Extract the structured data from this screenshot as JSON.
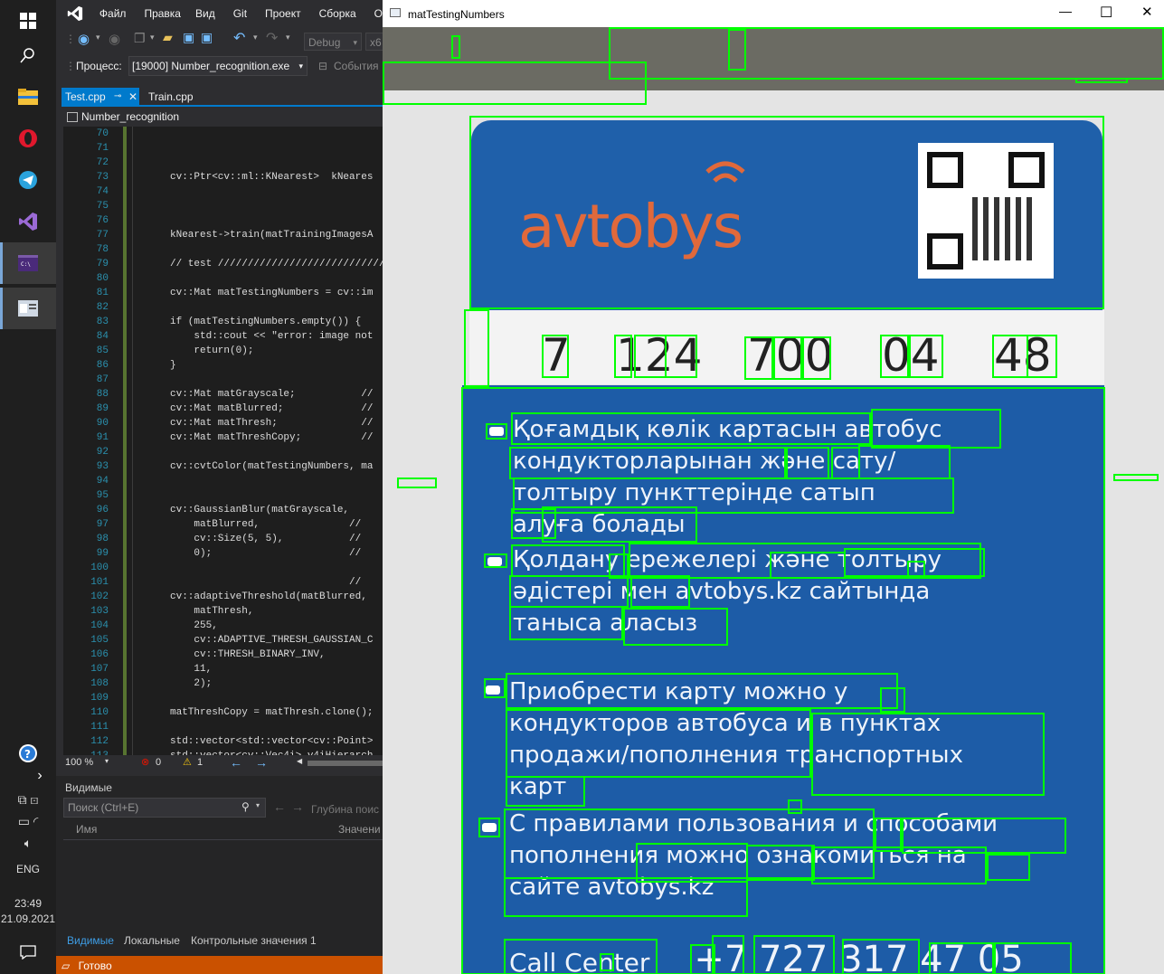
{
  "taskbar": {
    "time": "23:49",
    "date": "21.09.2021",
    "lang": "ENG"
  },
  "vs": {
    "menu": [
      "Файл",
      "Правка",
      "Вид",
      "Git",
      "Проект",
      "Сборка",
      "О"
    ],
    "config": "Debug",
    "platform": "x6",
    "process_label": "Процесс:",
    "process_value": "[19000] Number_recognition.exe",
    "events_label": "События",
    "tabs": [
      "Test.cpp",
      "Train.cpp"
    ],
    "breadcrumb": "Number_recognition",
    "code_lines": [
      {
        "n": "70",
        "t": ""
      },
      {
        "n": "71",
        "t": ""
      },
      {
        "n": "72",
        "t": ""
      },
      {
        "n": "73",
        "t": "cv::Ptr<cv::ml::KNearest>  kNeares"
      },
      {
        "n": "74",
        "t": ""
      },
      {
        "n": "75",
        "t": ""
      },
      {
        "n": "76",
        "t": ""
      },
      {
        "n": "77",
        "t": "kNearest->train(matTrainingImagesA"
      },
      {
        "n": "78",
        "t": ""
      },
      {
        "n": "79",
        "t": "// test ////////////////////////////"
      },
      {
        "n": "80",
        "t": ""
      },
      {
        "n": "81",
        "t": "cv::Mat matTestingNumbers = cv::im"
      },
      {
        "n": "82",
        "t": ""
      },
      {
        "n": "83",
        "t": "if (matTestingNumbers.empty()) {"
      },
      {
        "n": "84",
        "t": "    std::cout << \"error: image not"
      },
      {
        "n": "85",
        "t": "    return(0);"
      },
      {
        "n": "86",
        "t": "}"
      },
      {
        "n": "87",
        "t": ""
      },
      {
        "n": "88",
        "t": "cv::Mat matGrayscale;           //"
      },
      {
        "n": "89",
        "t": "cv::Mat matBlurred;             //"
      },
      {
        "n": "90",
        "t": "cv::Mat matThresh;              //"
      },
      {
        "n": "91",
        "t": "cv::Mat matThreshCopy;          //"
      },
      {
        "n": "92",
        "t": ""
      },
      {
        "n": "93",
        "t": "cv::cvtColor(matTestingNumbers, ma"
      },
      {
        "n": "94",
        "t": ""
      },
      {
        "n": "95",
        "t": ""
      },
      {
        "n": "96",
        "t": "cv::GaussianBlur(matGrayscale,"
      },
      {
        "n": "97",
        "t": "    matBlurred,               //"
      },
      {
        "n": "98",
        "t": "    cv::Size(5, 5),           //"
      },
      {
        "n": "99",
        "t": "    0);                       //"
      },
      {
        "n": "100",
        "t": ""
      },
      {
        "n": "101",
        "t": "                              //"
      },
      {
        "n": "102",
        "t": "cv::adaptiveThreshold(matBlurred,"
      },
      {
        "n": "103",
        "t": "    matThresh,"
      },
      {
        "n": "104",
        "t": "    255,"
      },
      {
        "n": "105",
        "t": "    cv::ADAPTIVE_THRESH_GAUSSIAN_C"
      },
      {
        "n": "106",
        "t": "    cv::THRESH_BINARY_INV,"
      },
      {
        "n": "107",
        "t": "    11,"
      },
      {
        "n": "108",
        "t": "    2);"
      },
      {
        "n": "109",
        "t": ""
      },
      {
        "n": "110",
        "t": "matThreshCopy = matThresh.clone();"
      },
      {
        "n": "111",
        "t": ""
      },
      {
        "n": "112",
        "t": "std::vector<std::vector<cv::Point>"
      },
      {
        "n": "113",
        "t": "std::vector<cv::Vec4i> v4iHierarch"
      }
    ],
    "zoom": "100 %",
    "errors": "0",
    "warnings": "1",
    "panel_title": "Видимые",
    "search_placeholder": "Поиск (Ctrl+E)",
    "depth_label": "Глубина поис",
    "col_name": "Имя",
    "col_value": "Значени",
    "bottom_tabs": [
      "Видимые",
      "Локальные",
      "Контрольные значения 1"
    ],
    "status": "Готово"
  },
  "image_window": {
    "title": "matTestingNumbers",
    "card": {
      "brand": "avtobys",
      "number_groups": [
        "7",
        "124",
        "700",
        "04",
        "48"
      ],
      "kz_lines": [
        "Қоғамдық көлік картасын автобус",
        "кондукторларынан және сату/",
        "толтыру пункттерінде сатып",
        "алуға болады",
        "Қолдану ережелері және толтыру",
        "әдістері мен avtobys.kz сайтында",
        "таныса аласыз"
      ],
      "ru_lines": [
        "Приобрести карту можно у",
        "кондукторов автобуса и в пунктах",
        "продажи/пополнения транспортных",
        "карт",
        "С правилами пользования и способами",
        "пополнения можно ознакомиться на",
        "сайте avtobys.kz"
      ],
      "call_center": "Call Center",
      "phone": "+7 727 317 47 05"
    }
  }
}
